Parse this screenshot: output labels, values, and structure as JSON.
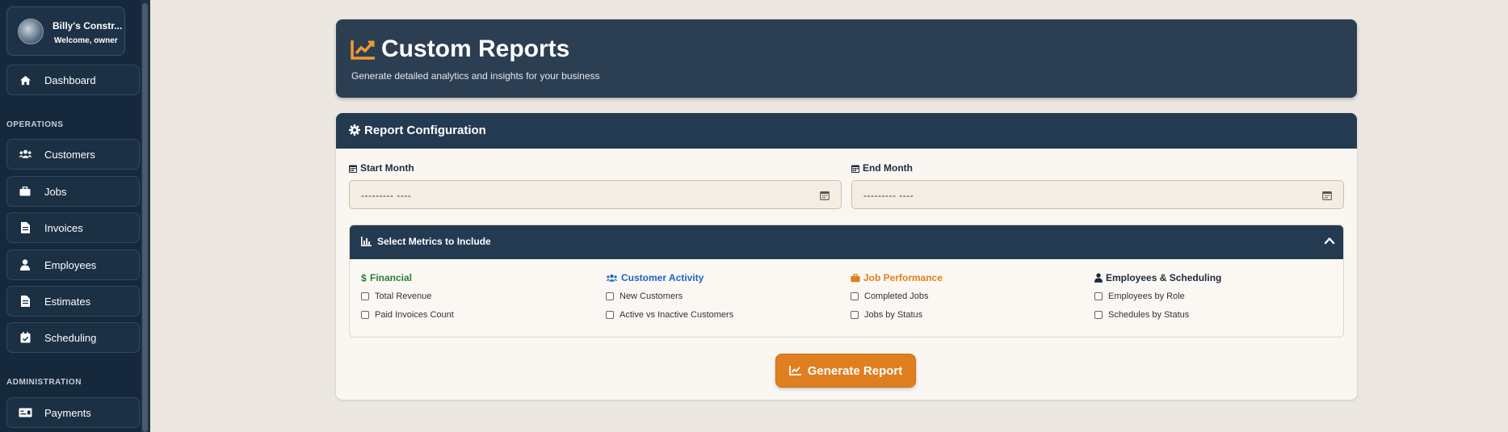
{
  "sidebar": {
    "brand": {
      "name": "Billy's Constr...",
      "subtitle": "Welcome, owner"
    },
    "items": {
      "dashboard": "Dashboard",
      "customers": "Customers",
      "jobs": "Jobs",
      "invoices": "Invoices",
      "employees": "Employees",
      "estimates": "Estimates",
      "scheduling": "Scheduling",
      "payments": "Payments"
    },
    "sections": {
      "operations": "OPERATIONS",
      "administration": "ADMINISTRATION"
    }
  },
  "header": {
    "title": "Custom Reports",
    "subtitle": "Generate detailed analytics and insights for your business",
    "icon": "line-chart-icon"
  },
  "config": {
    "title": "Report Configuration",
    "start_month": {
      "label": "Start Month",
      "value": "--------- ----"
    },
    "end_month": {
      "label": "End Month",
      "value": "--------- ----"
    },
    "metrics": {
      "title": "Select Metrics to Include",
      "groups": [
        {
          "title": "Financial",
          "color": "#2e7d32",
          "icon": "dollar-icon",
          "options": [
            "Total Revenue",
            "Paid Invoices Count"
          ]
        },
        {
          "title": "Customer Activity",
          "color": "#1e63c4",
          "icon": "users-icon",
          "options": [
            "New Customers",
            "Active vs Inactive Customers"
          ]
        },
        {
          "title": "Job Performance",
          "color": "#e07f1f",
          "icon": "briefcase-icon",
          "options": [
            "Completed Jobs",
            "Jobs by Status"
          ]
        },
        {
          "title": "Employees & Scheduling",
          "color": "#1e2b38",
          "icon": "user-tie-icon",
          "options": [
            "Employees by Role",
            "Schedules by Status"
          ]
        }
      ]
    },
    "generate_label": "Generate Report"
  },
  "colors": {
    "accent": "#e07f1f",
    "header_bg": "#2c3e52",
    "sidebar_bg": "#16283b"
  }
}
